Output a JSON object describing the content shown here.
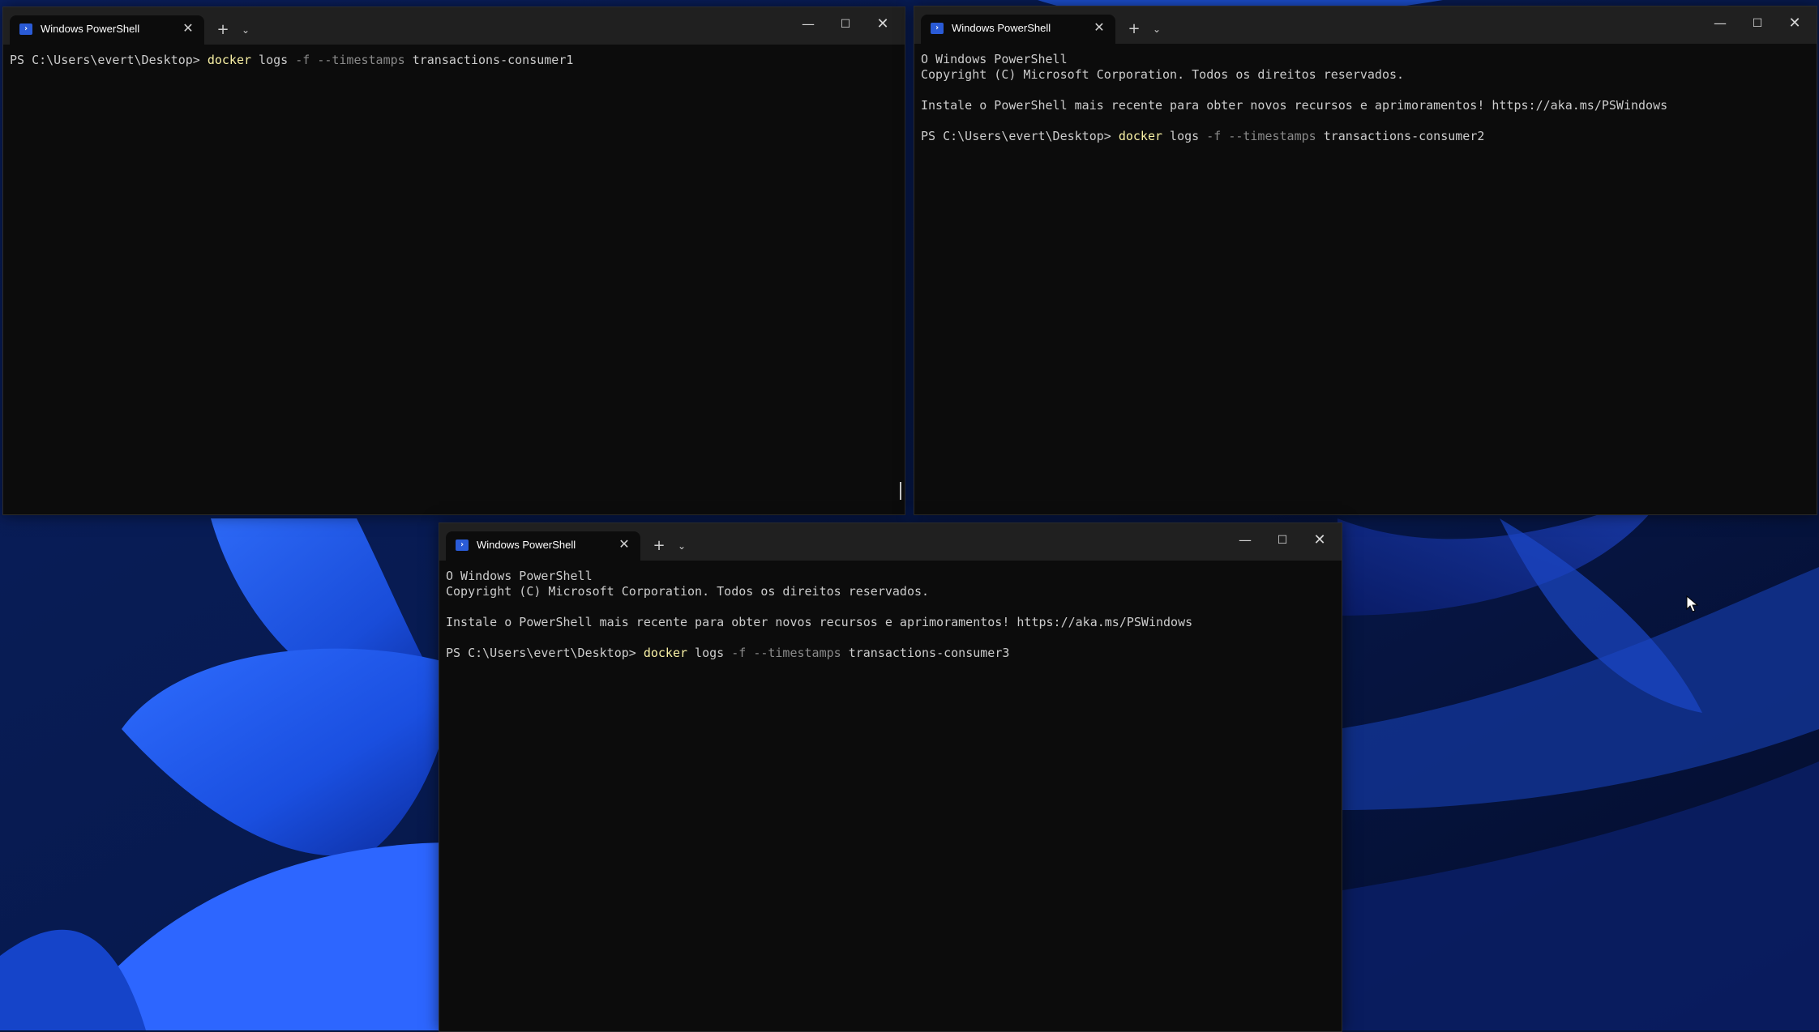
{
  "colors": {
    "desktop_bg": "#07163d",
    "wallpaper_blue": "#1f5de8",
    "terminal_bg": "#0c0c0c",
    "titlebar_bg": "#202020",
    "command_color": "#f9f1a5",
    "parameter_color": "#8a8a8a",
    "text_color": "#cccccc"
  },
  "icons": {
    "tab": "powershell-icon",
    "close": "close-icon",
    "new_tab": "plus-icon",
    "dropdown": "chevron-down-icon",
    "minimize": "minimize-icon",
    "maximize": "maximize-icon"
  },
  "glyphs": {
    "close": "✕",
    "plus": "+",
    "chevron": "⌄",
    "minimize": "—",
    "maximize": "☐",
    "ps": "›"
  },
  "windows": [
    {
      "tab_title": "Windows PowerShell",
      "lines": [
        {
          "prompt": "PS C:\\Users\\evert\\Desktop> ",
          "command": "docker",
          "arg1": " logs ",
          "param1": "-f",
          "sp": " ",
          "param2": "--timestamps",
          "arg2": " transactions-consumer1"
        }
      ]
    },
    {
      "tab_title": "Windows PowerShell",
      "banner": [
        "O Windows PowerShell",
        "Copyright (C) Microsoft Corporation. Todos os direitos reservados.",
        "",
        "Instale o PowerShell mais recente para obter novos recursos e aprimoramentos! https://aka.ms/PSWindows",
        ""
      ],
      "lines": [
        {
          "prompt": "PS C:\\Users\\evert\\Desktop> ",
          "command": "docker",
          "arg1": " logs ",
          "param1": "-f",
          "sp": " ",
          "param2": "--timestamps",
          "arg2": " transactions-consumer2"
        }
      ]
    },
    {
      "tab_title": "Windows PowerShell",
      "banner": [
        "O Windows PowerShell",
        "Copyright (C) Microsoft Corporation. Todos os direitos reservados.",
        "",
        "Instale o PowerShell mais recente para obter novos recursos e aprimoramentos! https://aka.ms/PSWindows",
        ""
      ],
      "lines": [
        {
          "prompt": "PS C:\\Users\\evert\\Desktop> ",
          "command": "docker",
          "arg1": " logs ",
          "param1": "-f",
          "sp": " ",
          "param2": "--timestamps",
          "arg2": " transactions-consumer3"
        }
      ]
    }
  ]
}
